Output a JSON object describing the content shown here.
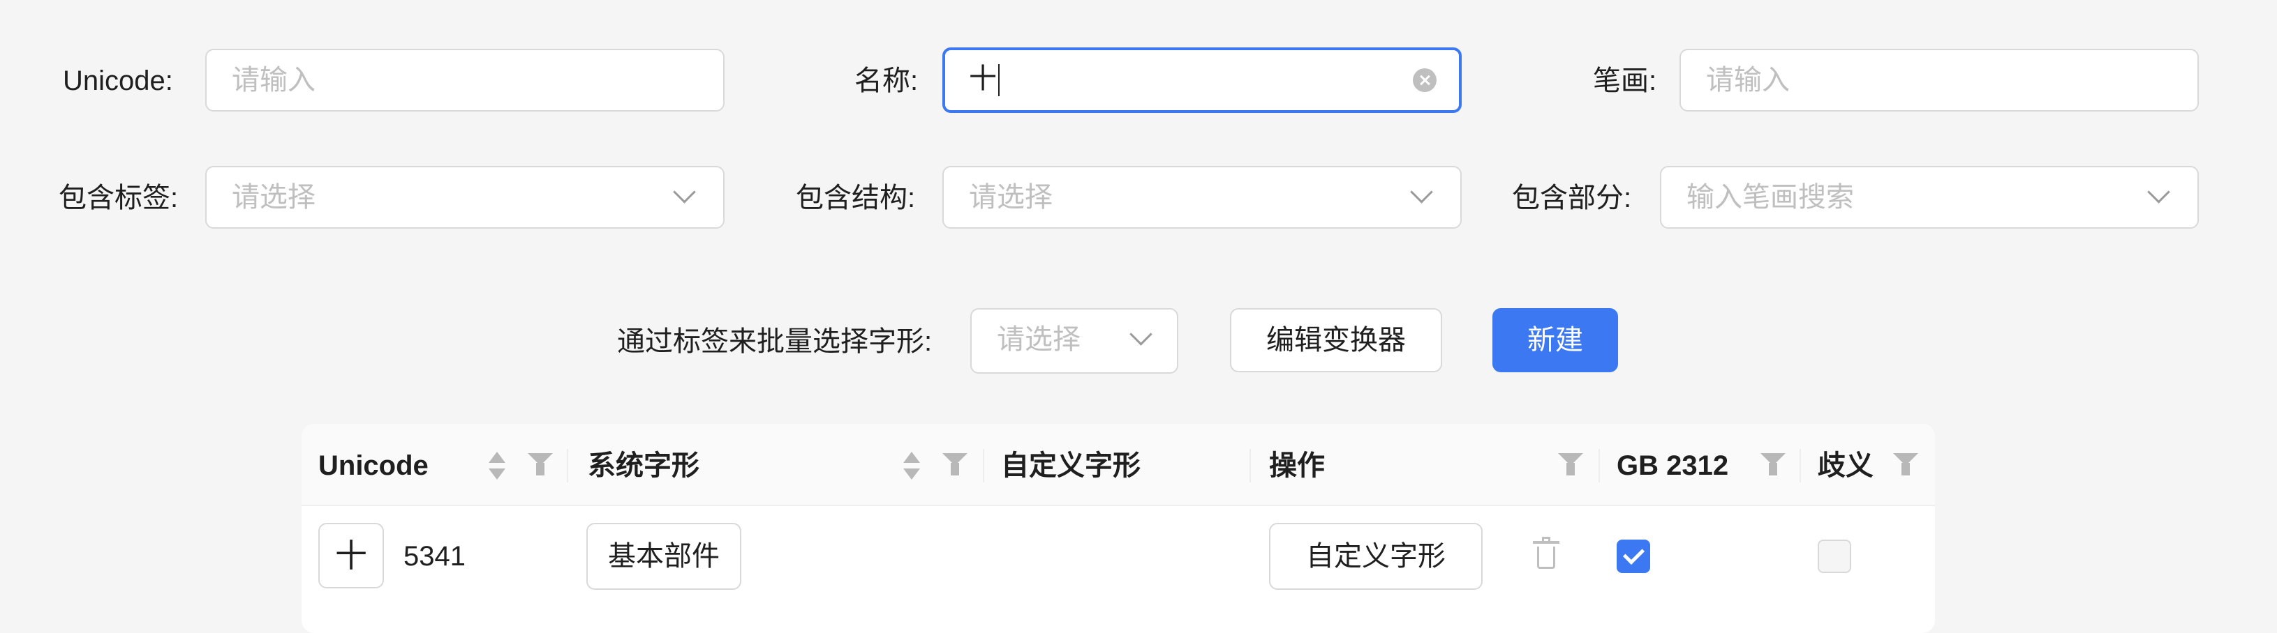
{
  "filters": {
    "unicode": {
      "label": "Unicode:",
      "placeholder": "请输入"
    },
    "name": {
      "label": "名称:",
      "value": "十"
    },
    "strokes": {
      "label": "笔画:",
      "placeholder": "请输入"
    },
    "tags": {
      "label": "包含标签:",
      "placeholder": "请选择"
    },
    "structure": {
      "label": "包含结构:",
      "placeholder": "请选择"
    },
    "parts": {
      "label": "包含部分:",
      "placeholder": "输入笔画搜索"
    }
  },
  "batch": {
    "label": "通过标签来批量选择字形:",
    "placeholder": "请选择",
    "edit_transformer_label": "编辑变换器",
    "new_label": "新建"
  },
  "table": {
    "columns": [
      "Unicode",
      "系统字形",
      "自定义字形",
      "操作",
      "GB 2312",
      "歧义"
    ],
    "rows": [
      {
        "glyph": "十",
        "unicode": "5341",
        "system_glyph": "基本部件",
        "custom_glyph_action": "自定义字形",
        "gb2312": true,
        "ambiguous": false
      }
    ]
  },
  "colors": {
    "primary": "#3b78f2",
    "background": "#f5f5f5"
  },
  "icons": [
    "clear-icon",
    "chevron-down-icon",
    "sort-icon",
    "filter-icon",
    "trash-icon",
    "checkbox-icon"
  ]
}
